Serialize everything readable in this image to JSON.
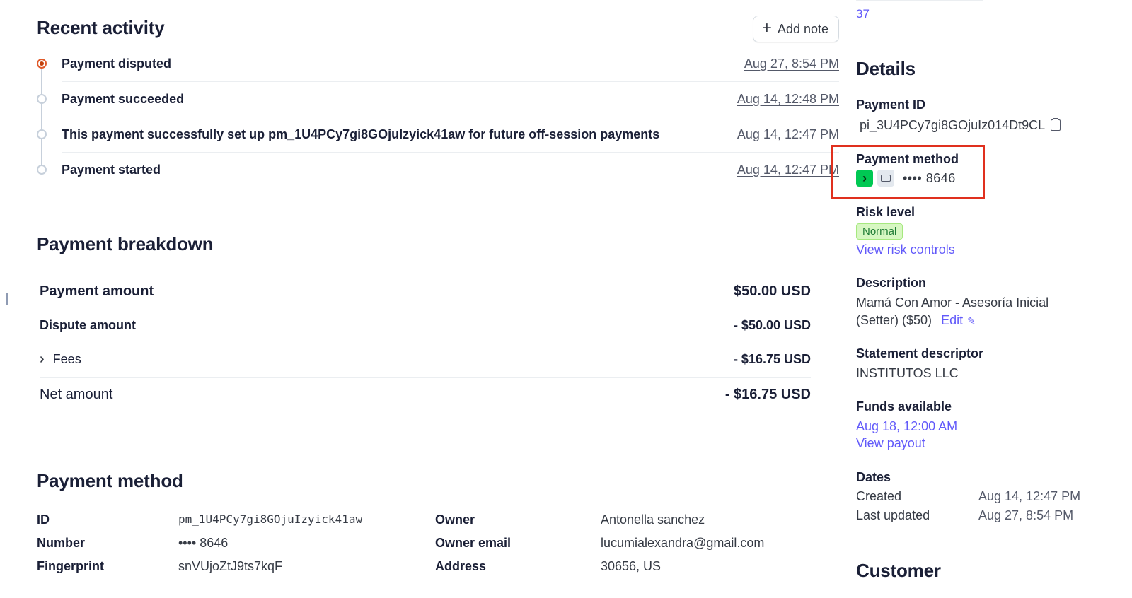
{
  "recent_activity": {
    "title": "Recent activity",
    "add_note_label": "Add note",
    "events": [
      {
        "text": "Payment disputed",
        "date": "Aug 27, 8:54 PM",
        "active": true
      },
      {
        "text": "Payment succeeded",
        "date": "Aug 14, 12:48 PM",
        "active": false
      },
      {
        "text": "This payment successfully set up pm_1U4PCy7gi8GOjuIzyick41aw for future off-session payments",
        "date": "Aug 14, 12:47 PM",
        "active": false
      },
      {
        "text": "Payment started",
        "date": "Aug 14, 12:47 PM",
        "active": false
      }
    ]
  },
  "payment_breakdown": {
    "title": "Payment breakdown",
    "payment_amount_label": "Payment amount",
    "payment_amount_value": "$50.00 USD",
    "dispute_amount_label": "Dispute amount",
    "dispute_amount_value": "- $50.00 USD",
    "fees_label": "Fees",
    "fees_value": "- $16.75 USD",
    "net_amount_label": "Net amount",
    "net_amount_value": "- $16.75 USD"
  },
  "payment_method_section": {
    "title": "Payment method",
    "id_label": "ID",
    "id_value": "pm_1U4PCy7gi8GOjuIzyick41aw",
    "number_label": "Number",
    "number_value": "•••• 8646",
    "fingerprint_label": "Fingerprint",
    "fingerprint_value": "snVUjoZtJ9ts7kqF",
    "owner_label": "Owner",
    "owner_value": "Antonella sanchez",
    "owner_email_label": "Owner email",
    "owner_email_value": "lucumialexandra@gmail.com",
    "address_label": "Address",
    "address_value": "30656, US"
  },
  "sidebar": {
    "top_number": "37",
    "details_title": "Details",
    "payment_id_label": "Payment ID",
    "payment_id_value": "pi_3U4PCy7gi8GOjuIz014Dt9CL",
    "payment_method_label": "Payment method",
    "payment_method_last4": "•••• 8646",
    "risk_level_label": "Risk level",
    "risk_level_badge": "Normal",
    "view_risk_controls": "View risk controls",
    "description_label": "Description",
    "description_line1": "Mamá Con Amor - Asesoría Inicial",
    "description_line2": "(Setter) ($50)",
    "edit_label": "Edit",
    "statement_descriptor_label": "Statement descriptor",
    "statement_descriptor_value": "INSTITUTOS LLC",
    "funds_available_label": "Funds available",
    "funds_available_value": "Aug 18, 12:00 AM",
    "view_payout": "View payout",
    "dates_label": "Dates",
    "created_label": "Created",
    "created_value": "Aug 14, 12:47 PM",
    "last_updated_label": "Last updated",
    "last_updated_value": "Aug 27, 8:54 PM",
    "customer_title": "Customer"
  },
  "colors": {
    "accent": "#625afa",
    "highlight_box": "#e0301e",
    "active_dot": "#c2410c",
    "badge_bg": "#d7f7c2"
  }
}
